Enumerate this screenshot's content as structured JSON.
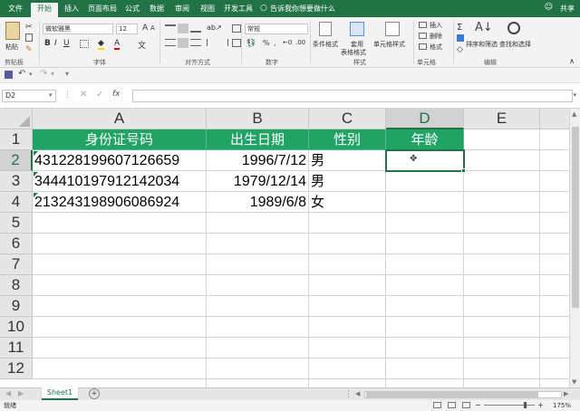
{
  "tabs": [
    {
      "label": "文件"
    },
    {
      "label": "开始"
    },
    {
      "label": "插入"
    },
    {
      "label": "页面布局"
    },
    {
      "label": "公式"
    },
    {
      "label": "数据"
    },
    {
      "label": "审阅"
    },
    {
      "label": "视图"
    },
    {
      "label": "开发工具"
    }
  ],
  "tell_me": "告诉我你想要做什么",
  "share": "共享",
  "ribbon": {
    "paste": "粘贴",
    "clipboard": "剪贴板",
    "font_name": "微软雅黑",
    "font_size": "12",
    "font_group": "字体",
    "align_group": "对齐方式",
    "number_format": "常规",
    "number_group": "数字",
    "cond_format": "条件格式",
    "table_format_1": "套用",
    "table_format_2": "表格格式",
    "cell_style": "单元格样式",
    "styles_group": "样式",
    "insert": "插入",
    "delete": "删除",
    "format": "格式",
    "cells_group": "单元格",
    "sort_filter": "排序和筛选",
    "find_select": "查找和选择",
    "editing_group": "编辑"
  },
  "formula_bar": {
    "name_box": "D2",
    "formula": ""
  },
  "columns": [
    "A",
    "B",
    "C",
    "D",
    "E"
  ],
  "rows": [
    "1",
    "2",
    "3",
    "4",
    "5",
    "6",
    "7",
    "8",
    "9",
    "10",
    "11",
    "12"
  ],
  "table": {
    "headers": [
      "身份证号码",
      "出生日期",
      "性别",
      "年龄"
    ],
    "data": [
      [
        "431228199607126659",
        "1996/7/12",
        "男",
        ""
      ],
      [
        "344410197912142034",
        "1979/12/14",
        "男",
        ""
      ],
      [
        "213243198906086924",
        "1989/6/8",
        "女",
        ""
      ]
    ]
  },
  "sheet_tab": "Sheet1",
  "status": "就绪",
  "zoom": "175%",
  "colors": {
    "accent": "#217346",
    "header_fill": "#21a366"
  }
}
